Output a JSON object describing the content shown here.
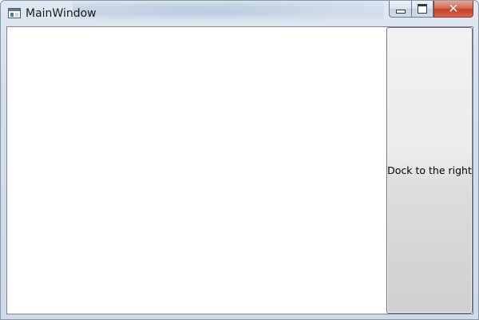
{
  "window": {
    "title": "MainWindow",
    "app_icon": "window-icon",
    "caption_buttons": {
      "minimize_icon": "minimize-icon",
      "maximize_icon": "maximize-icon",
      "close_icon": "close-icon",
      "close_glyph": "✕"
    }
  },
  "content": {
    "dock_right_button_label": "Dock to the right"
  },
  "colors": {
    "close_button": "#c94a32",
    "client_background": "#ffffff",
    "button_face": "#e6e6e6"
  }
}
